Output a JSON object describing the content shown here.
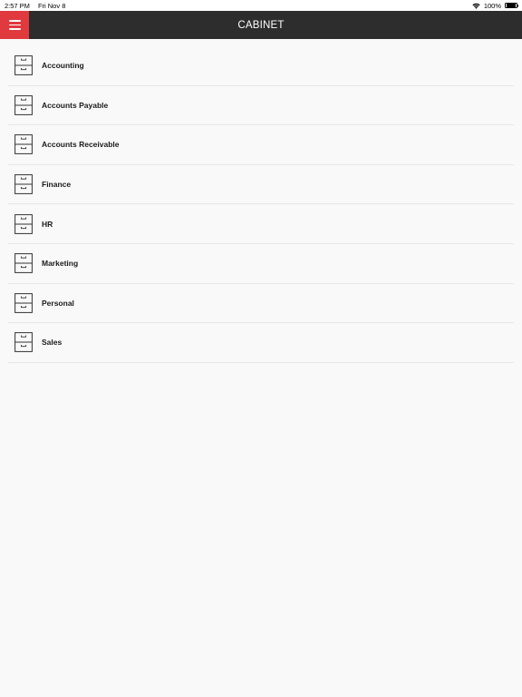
{
  "status_bar": {
    "time": "2:57 PM",
    "date": "Fri Nov 8",
    "battery_percent": "100%",
    "wifi_icon": "wifi-icon",
    "battery_level": 1.0
  },
  "nav": {
    "title": "CABINET",
    "menu_icon": "hamburger-menu-icon",
    "accent_color": "#e0393e",
    "bar_color": "#2d2d2d"
  },
  "cabinet": {
    "icon": "file-cabinet-icon",
    "items": [
      {
        "label": "Accounting"
      },
      {
        "label": "Accounts Payable"
      },
      {
        "label": "Accounts Receivable"
      },
      {
        "label": "Finance"
      },
      {
        "label": "HR"
      },
      {
        "label": "Marketing"
      },
      {
        "label": "Personal"
      },
      {
        "label": "Sales"
      }
    ]
  }
}
